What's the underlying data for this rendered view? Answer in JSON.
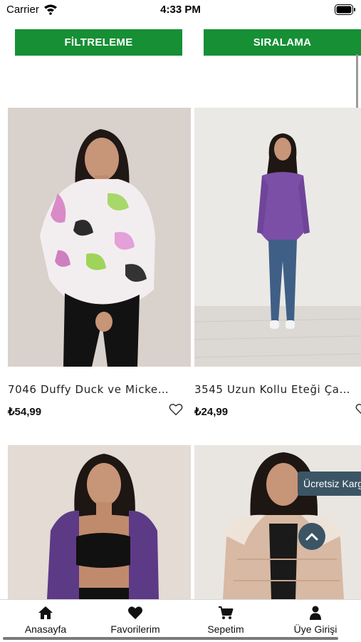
{
  "status_bar": {
    "carrier": "Carrier",
    "time": "4:33 PM"
  },
  "toolbar": {
    "filter_label": "FİLTRELEME",
    "sort_label": "SIRALAMA"
  },
  "products": [
    {
      "title": "7046 Duffy Duck ve Micke…",
      "price": "₺54,99"
    },
    {
      "title": "3545 Uzun Kollu Eteği Ça…",
      "price": "₺24,99"
    }
  ],
  "free_cargo_badge": "Ücretsiz Kargo",
  "bottom_nav": [
    {
      "label": "Anasayfa",
      "icon": "home-icon"
    },
    {
      "label": "Favorilerim",
      "icon": "heart-icon"
    },
    {
      "label": "Sepetim",
      "icon": "cart-icon"
    },
    {
      "label": "Üye Girişi",
      "icon": "user-icon"
    }
  ],
  "colors": {
    "accent_green": "#168f35",
    "badge_slate": "#3b5565"
  }
}
